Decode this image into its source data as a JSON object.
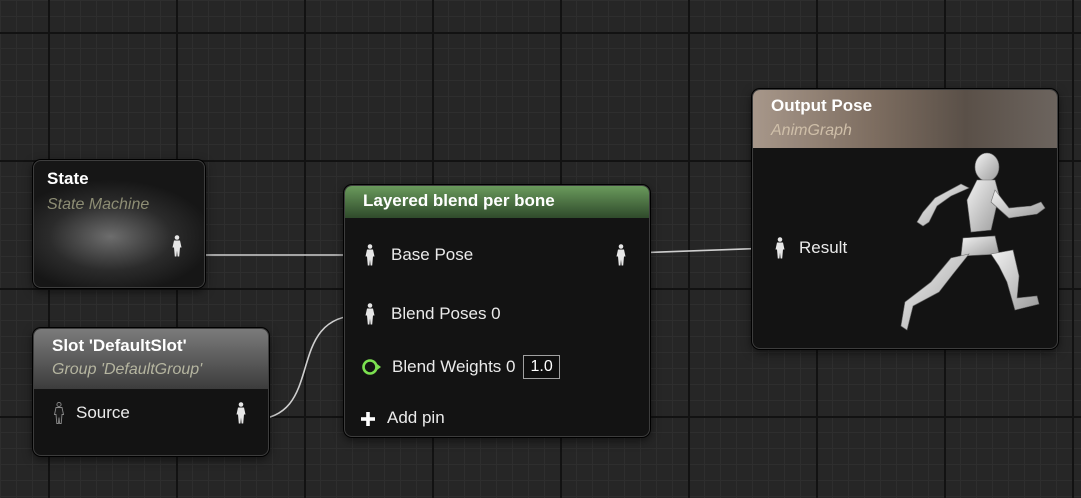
{
  "graph": {
    "state_node": {
      "title": "State",
      "subtitle": "State Machine"
    },
    "slot_node": {
      "title": "Slot 'DefaultSlot'",
      "subtitle": "Group 'DefaultGroup'",
      "input_label": "Source"
    },
    "blend_node": {
      "title": "Layered blend per bone",
      "base_pose_label": "Base Pose",
      "blend_poses_label": "Blend Poses 0",
      "blend_weights_label": "Blend Weights 0",
      "blend_weights_value": "1.0",
      "add_pin_label": "Add pin"
    },
    "output_node": {
      "title": "Output Pose",
      "subtitle": "AnimGraph",
      "result_label": "Result"
    }
  },
  "icons": {
    "pose_pin": "pose-pin-icon",
    "exec_pin": "float-pin-icon",
    "add": "plus-icon",
    "preview": "mannequin-running-icon"
  },
  "colors": {
    "background": "#262626",
    "blend_header": "#6a9a5c",
    "slot_header": "#7b7b7b",
    "output_header": "#a7978a",
    "float_pin": "#7ce050",
    "wire": "#cfcfcf"
  }
}
